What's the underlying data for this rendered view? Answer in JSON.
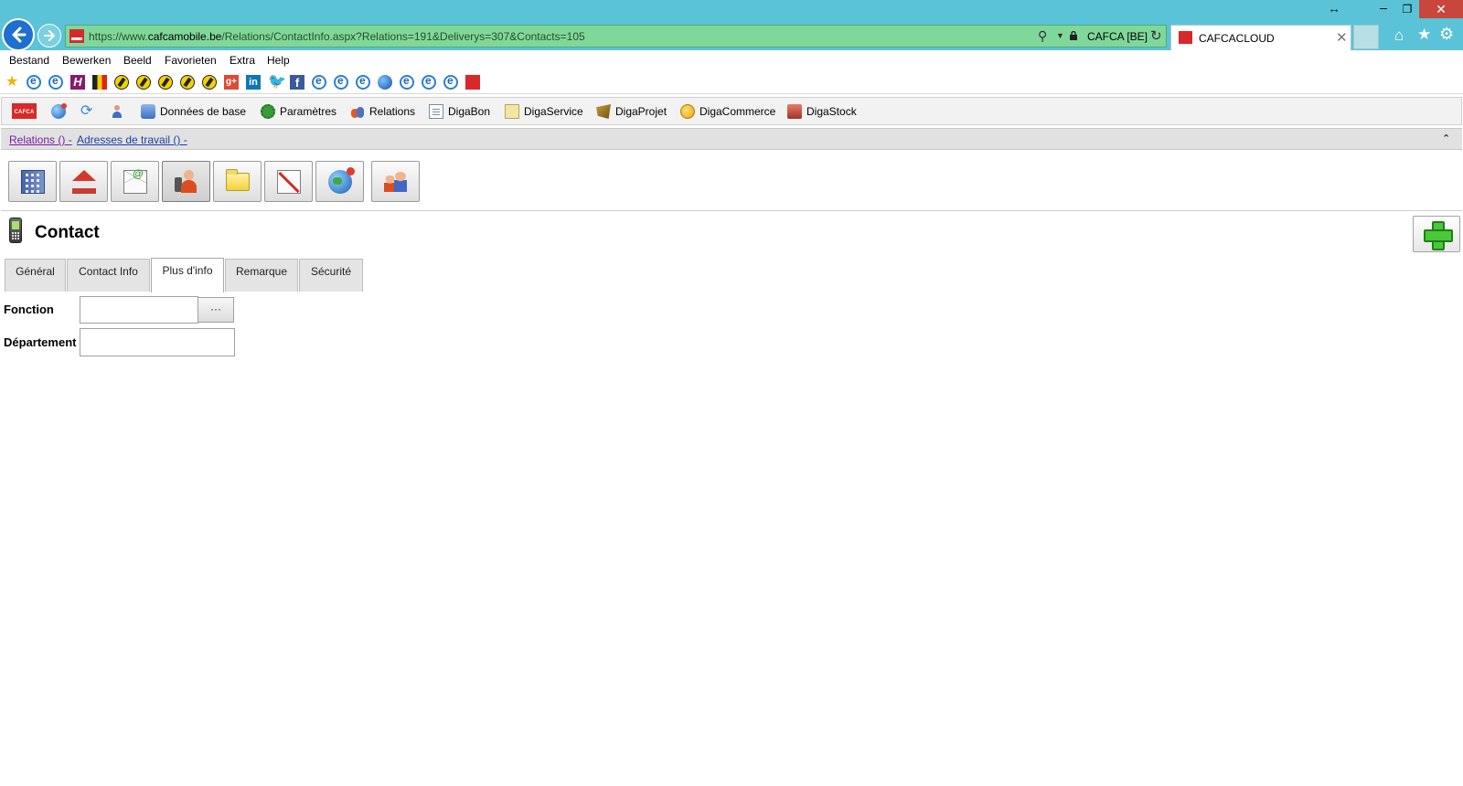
{
  "browser": {
    "url_scheme": "https://",
    "url_prefix": "www.",
    "url_host": "cafcamobile.be",
    "url_path": "/Relations/ContactInfo.aspx?Relations=191&Deliverys=307&Contacts=105",
    "cert_label": "CAFCA [BE]",
    "tab_title": "CAFCACLOUD"
  },
  "menu": {
    "items": [
      "Bestand",
      "Bewerken",
      "Beeld",
      "Favorieten",
      "Extra",
      "Help"
    ]
  },
  "app_toolbar": {
    "logo_text": "CAFCA",
    "items": [
      "Données de base",
      "Paramètres",
      "Relations",
      "DigaBon",
      "DigaService",
      "DigaProjet",
      "DigaCommerce",
      "DigaStock"
    ]
  },
  "breadcrumb": {
    "relations": "Relations () -",
    "adresses": "Adresses de travail () -"
  },
  "page": {
    "title": "Contact"
  },
  "tabs": [
    "Général",
    "Contact Info",
    "Plus d'info",
    "Remarque",
    "Sécurité"
  ],
  "active_tab": "Plus d'info",
  "form": {
    "fonction_label": "Fonction",
    "fonction_value": "",
    "browse_label": "···",
    "departement_label": "Département",
    "departement_value": ""
  },
  "colors": {
    "chrome": "#5bc3d7",
    "address_bar": "#7fd89a",
    "close_button": "#c8473d",
    "brand_red": "#d9282a",
    "add_green": "#4bc83a"
  }
}
